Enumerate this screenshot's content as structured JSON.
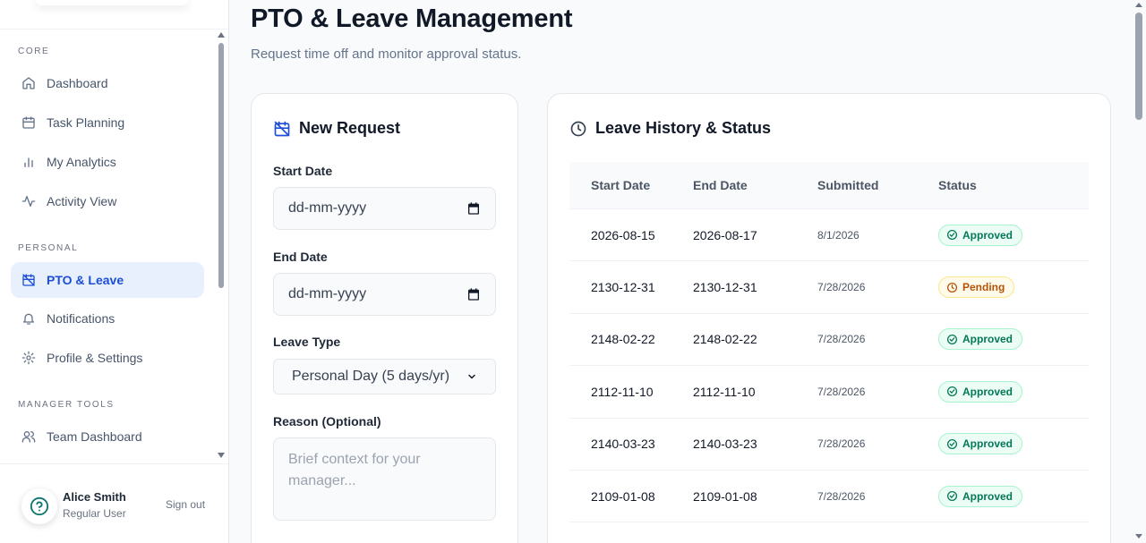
{
  "sidebar": {
    "sections": [
      {
        "label": "CORE"
      },
      {
        "label": "PERSONAL"
      },
      {
        "label": "MANAGER TOOLS"
      }
    ],
    "items": [
      {
        "label": "Dashboard",
        "icon": "home-icon"
      },
      {
        "label": "Task Planning",
        "icon": "calendar-icon"
      },
      {
        "label": "My Analytics",
        "icon": "bar-chart-icon"
      },
      {
        "label": "Activity View",
        "icon": "activity-icon"
      },
      {
        "label": "PTO & Leave",
        "icon": "calendar-off-icon",
        "active": true
      },
      {
        "label": "Notifications",
        "icon": "bell-icon"
      },
      {
        "label": "Profile & Settings",
        "icon": "gear-icon"
      },
      {
        "label": "Team Dashboard",
        "icon": "users-icon"
      }
    ],
    "user": {
      "name": "Alice Smith",
      "role": "Regular User",
      "sign_out": "Sign out"
    }
  },
  "page": {
    "title": "PTO & Leave Management",
    "subtitle": "Request time off and monitor approval status."
  },
  "request_form": {
    "title": "New Request",
    "start_date": {
      "label": "Start Date",
      "placeholder": "dd-mm-yyyy"
    },
    "end_date": {
      "label": "End Date",
      "placeholder": "dd-mm-yyyy"
    },
    "leave_type": {
      "label": "Leave Type",
      "value": "Personal Day (5 days/yr)"
    },
    "reason": {
      "label": "Reason (Optional)",
      "placeholder": "Brief context for your manager..."
    }
  },
  "history": {
    "title": "Leave History & Status",
    "columns": [
      "Start Date",
      "End Date",
      "Submitted",
      "Status"
    ],
    "rows": [
      {
        "start": "2026-08-15",
        "end": "2026-08-17",
        "submitted": "8/1/2026",
        "status": "Approved"
      },
      {
        "start": "2130-12-31",
        "end": "2130-12-31",
        "submitted": "7/28/2026",
        "status": "Pending"
      },
      {
        "start": "2148-02-22",
        "end": "2148-02-22",
        "submitted": "7/28/2026",
        "status": "Approved"
      },
      {
        "start": "2112-11-10",
        "end": "2112-11-10",
        "submitted": "7/28/2026",
        "status": "Approved"
      },
      {
        "start": "2140-03-23",
        "end": "2140-03-23",
        "submitted": "7/28/2026",
        "status": "Approved"
      },
      {
        "start": "2109-01-08",
        "end": "2109-01-08",
        "submitted": "7/28/2026",
        "status": "Approved"
      }
    ]
  },
  "colors": {
    "accent": "#1d4ed8",
    "active_bg": "#e8f0fd",
    "approved": "#047857",
    "pending": "#b45309"
  }
}
